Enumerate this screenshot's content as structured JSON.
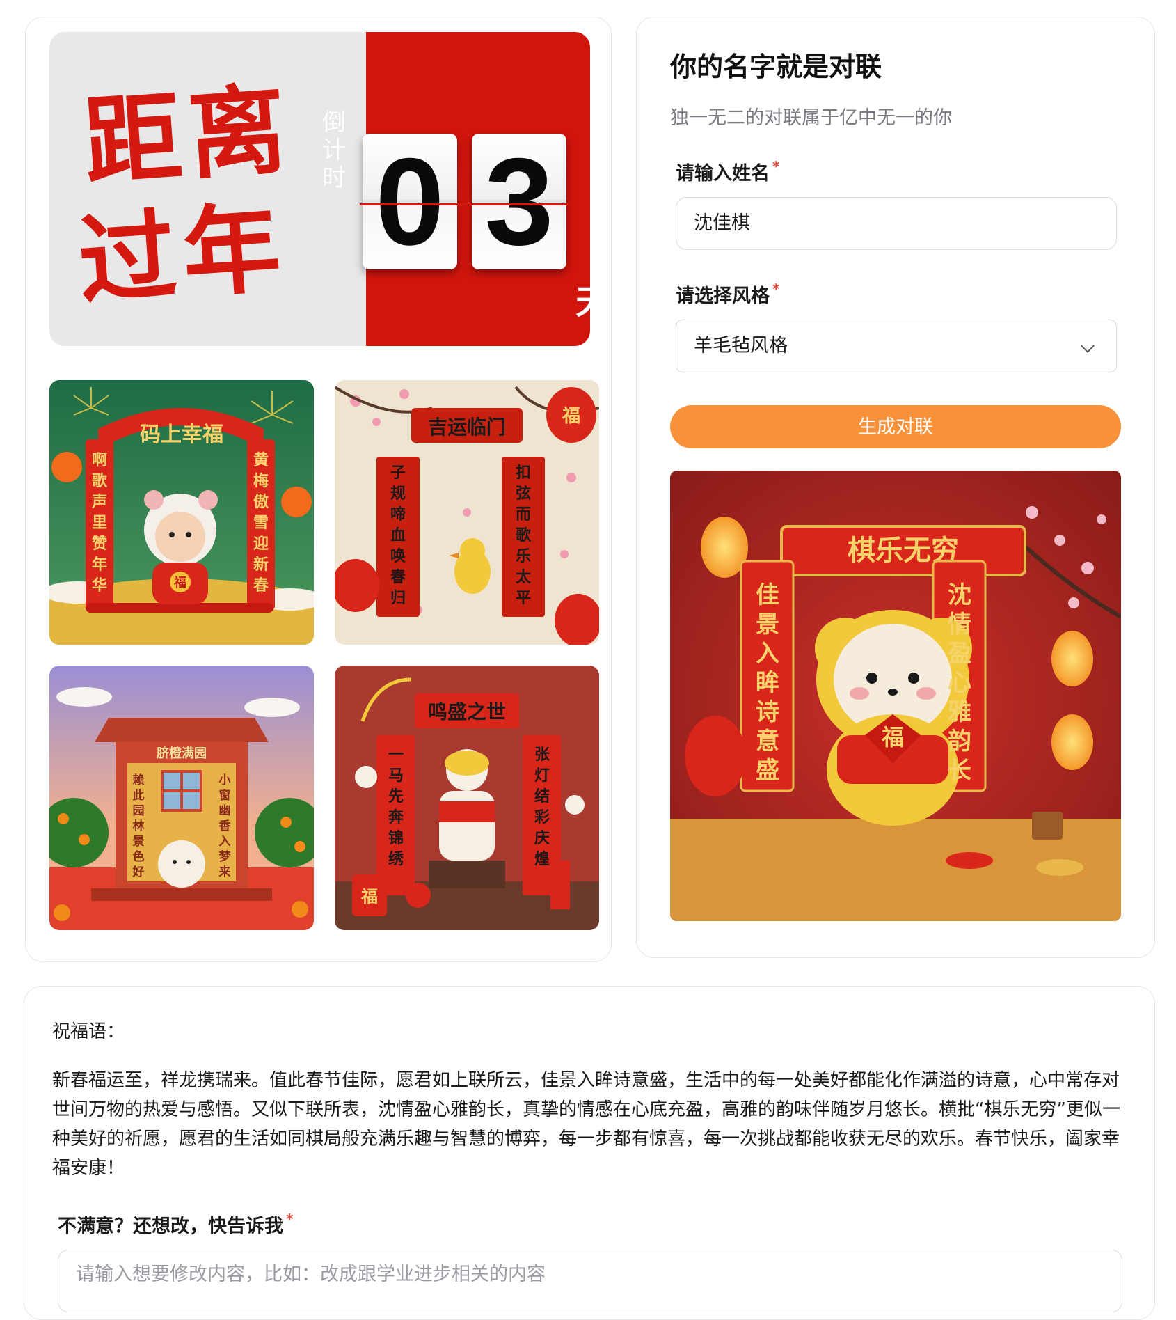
{
  "countdown": {
    "title_line1": "距离",
    "title_line2": "过年",
    "vertical_label": [
      "倒",
      "计",
      "时"
    ],
    "digit1": "0",
    "digit2": "3",
    "unit": "天"
  },
  "gallery": [
    {
      "banner": "码上幸福",
      "left": "啊歌声里赞年华",
      "right": "黄梅傲雪迎新春",
      "fu": "福"
    },
    {
      "banner": "吉运临门",
      "left": "子规啼血唤春归",
      "right": "扣弦而歌乐太平",
      "fu": "福"
    },
    {
      "banner": "脐橙满园",
      "left": "赖此园林景色好",
      "right": "小窗幽香入梦来"
    },
    {
      "banner": "鸣盛之世",
      "left": "一马先奔锦绣",
      "right": "张灯结彩庆煌",
      "fu": "福"
    }
  ],
  "form": {
    "title": "你的名字就是对联",
    "subtitle": "独一无二的对联属于亿中无一的你",
    "name_label": "请输入姓名",
    "name_value": "沈佳棋",
    "style_label": "请选择风格",
    "style_value": "羊毛毡风格",
    "required_mark": "*",
    "generate_button": "生成对联"
  },
  "result": {
    "banner": "棋乐无穷",
    "left": "佳景入眸诗意盛",
    "right": "沈情盈心雅韵长",
    "fu": "福"
  },
  "blessing": {
    "label": "祝福语：",
    "text": "新春福运至，祥龙携瑞来。值此春节佳际，愿君如上联所云，佳景入眸诗意盛，生活中的每一处美好都能化作满溢的诗意，心中常存对世间万物的热爱与感悟。又似下联所表，沈情盈心雅韵长，真挚的情感在心底充盈，高雅的韵味伴随岁月悠长。横批“棋乐无穷”更似一种美好的祈愿，愿君的生活如同棋局般充满乐趣与智慧的博弈，每一步都有惊喜，每一次挑战都能收获无尽的欢乐。春节快乐，阖家幸福安康！"
  },
  "feedback": {
    "label": "不满意？还想改，快告诉我",
    "placeholder": "请输入想要修改内容，比如：改成跟学业进步相关的内容"
  },
  "colors": {
    "festival_red": "#d0150d",
    "button_orange": "#f8923a",
    "required_red": "#e5483a"
  }
}
